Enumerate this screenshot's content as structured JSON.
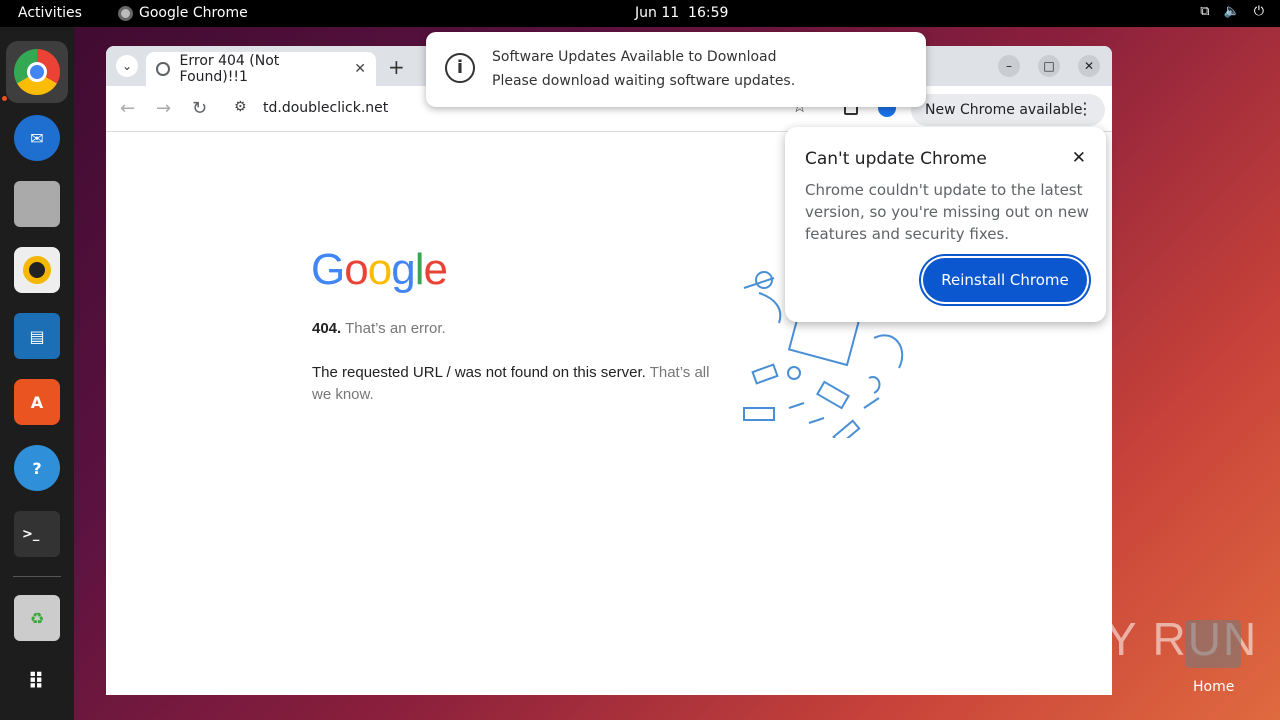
{
  "topbar": {
    "activities": "Activities",
    "app_name": "Google Chrome",
    "date": "Jun 11",
    "time": "16:59",
    "tray_icons": [
      "network-icon",
      "volume-icon",
      "power-icon"
    ]
  },
  "dock": {
    "items": [
      "google-chrome",
      "thunderbird",
      "files",
      "rhythmbox",
      "libreoffice-writer",
      "app-center",
      "help",
      "terminal",
      "trash",
      "show-apps"
    ]
  },
  "browser": {
    "tab_title": "Error 404 (Not Found)!!1",
    "url": "td.doubleclick.net",
    "new_chrome_label": "New Chrome available"
  },
  "page": {
    "logo": [
      "G",
      "o",
      "o",
      "g",
      "l",
      "e"
    ],
    "code": "404.",
    "code_text": "That’s an error.",
    "message": "The requested URL / was not found on this server.",
    "message_muted": "That’s all we know."
  },
  "notification": {
    "title": "Software Updates Available to Download",
    "body": "Please download waiting software updates."
  },
  "popup": {
    "title": "Can't update Chrome",
    "body": "Chrome couldn't update to the latest version, so you're missing out on new features and security fixes.",
    "button": "Reinstall Chrome"
  },
  "desktop": {
    "watermark": "ANY RUN",
    "home_label": "Home"
  },
  "colors": {
    "accent": "#0b57d0",
    "ubuntu_orange": "#e95420"
  }
}
